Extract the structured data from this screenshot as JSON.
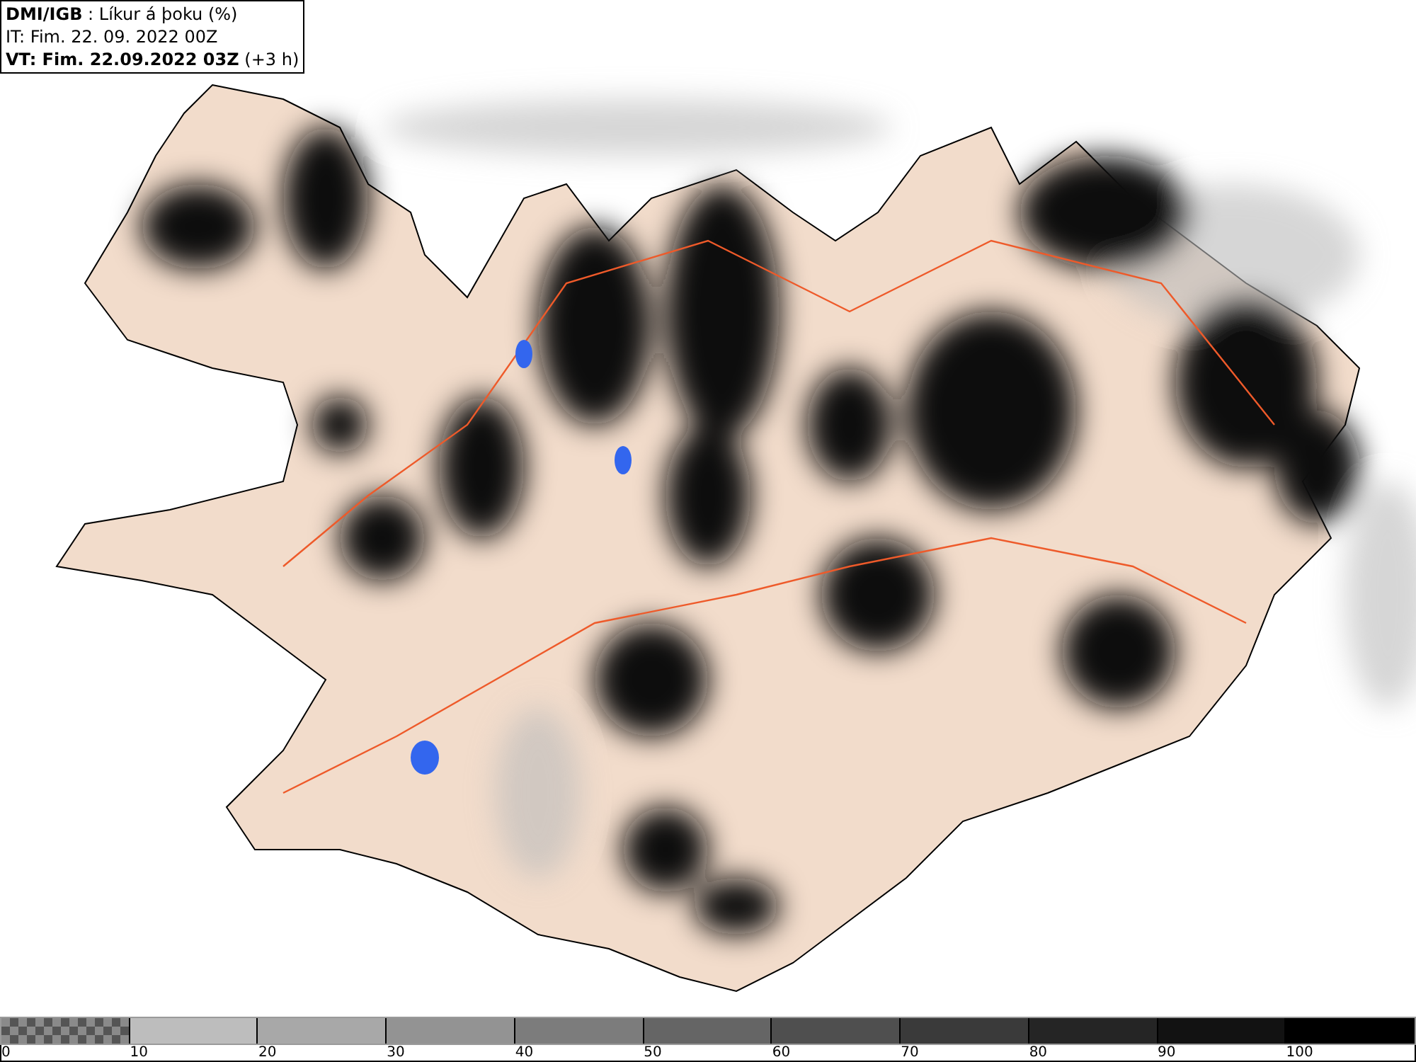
{
  "header": {
    "title": "**DMI/IGB** : Líkur á þoku (%)",
    "issue_time": "IT: Fim. 22. 09. 2022 00Z",
    "valid_time": "**VT: Fim. 22.09.2022 03Z** (+3 h)"
  },
  "legend": {
    "bins": [
      {
        "kind": "checker",
        "color": "#555555"
      },
      {
        "kind": "solid",
        "color": "#bdbdbd"
      },
      {
        "kind": "solid",
        "color": "#a8a8a8"
      },
      {
        "kind": "solid",
        "color": "#939393"
      },
      {
        "kind": "solid",
        "color": "#7c7c7c"
      },
      {
        "kind": "solid",
        "color": "#656565"
      },
      {
        "kind": "solid",
        "color": "#4f4f4f"
      },
      {
        "kind": "solid",
        "color": "#3a3a3a"
      },
      {
        "kind": "solid",
        "color": "#252525"
      },
      {
        "kind": "solid",
        "color": "#121212"
      },
      {
        "kind": "solid",
        "color": "#000000"
      }
    ],
    "labels": [
      "0",
      "10",
      "20",
      "30",
      "40",
      "50",
      "60",
      "70",
      "80",
      "90",
      "100"
    ]
  }
}
